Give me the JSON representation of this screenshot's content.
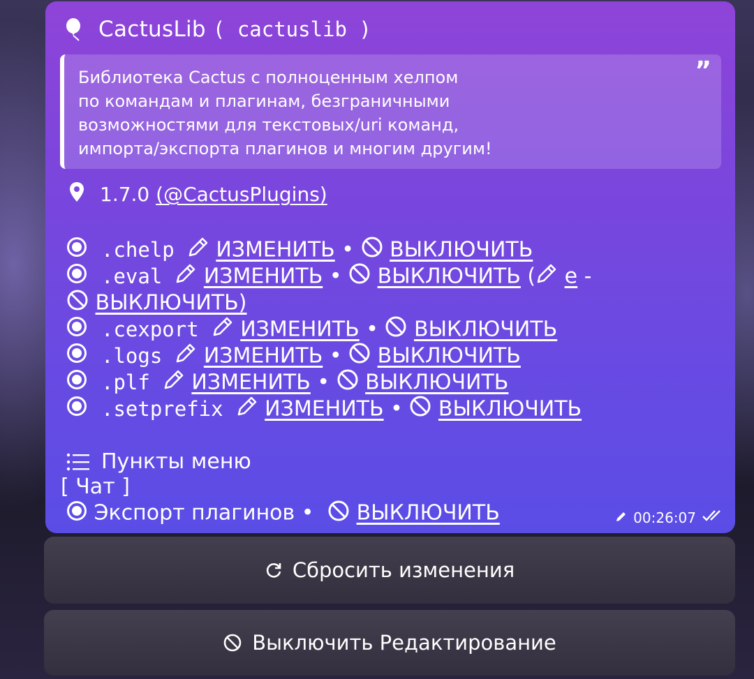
{
  "header": {
    "name": "CactusLib",
    "id_text": "( cactuslib )",
    "icon": "balloon-icon"
  },
  "description": {
    "lines": [
      "Библиотека Cactus с полноценным хелпом",
      "по командам и плагинам, безграничными",
      "возможностями для текстовых/uri команд,",
      "импорта/экспорта плагинов и многим другим!"
    ],
    "quote_mark": "”"
  },
  "version": {
    "number": "1.7.0",
    "author": "(@CactusPlugins)",
    "icon": "location-pin-icon"
  },
  "actions": {
    "edit": "ИЗМЕНИТЬ",
    "disable": "ВЫКЛЮЧИТЬ",
    "separator": "•"
  },
  "commands": [
    {
      "name": ".chelp"
    },
    {
      "name": ".eval",
      "extra_open": "(",
      "extra_alias": "e",
      "extra_dash": "-",
      "extra_disable": "ВЫКЛЮЧИТЬ)"
    },
    {
      "name": ".cexport"
    },
    {
      "name": ".logs"
    },
    {
      "name": ".plf"
    },
    {
      "name": ".setprefix"
    }
  ],
  "menu": {
    "title": "Пункты меню",
    "icon": "list-icon",
    "chat_label": "[ Чат ]",
    "export_item": "Экспорт плагинов"
  },
  "message_meta": {
    "time": "00:26:07",
    "edited_icon": "pencil-icon",
    "status_icon": "double-check-icon"
  },
  "buttons": {
    "reset": "Сбросить изменения",
    "disable_edit": "Выключить Редактирование"
  },
  "colors": {
    "bubble_top": "#8f44d8",
    "bubble_bottom": "#5a4de6",
    "text": "#ffffff"
  }
}
